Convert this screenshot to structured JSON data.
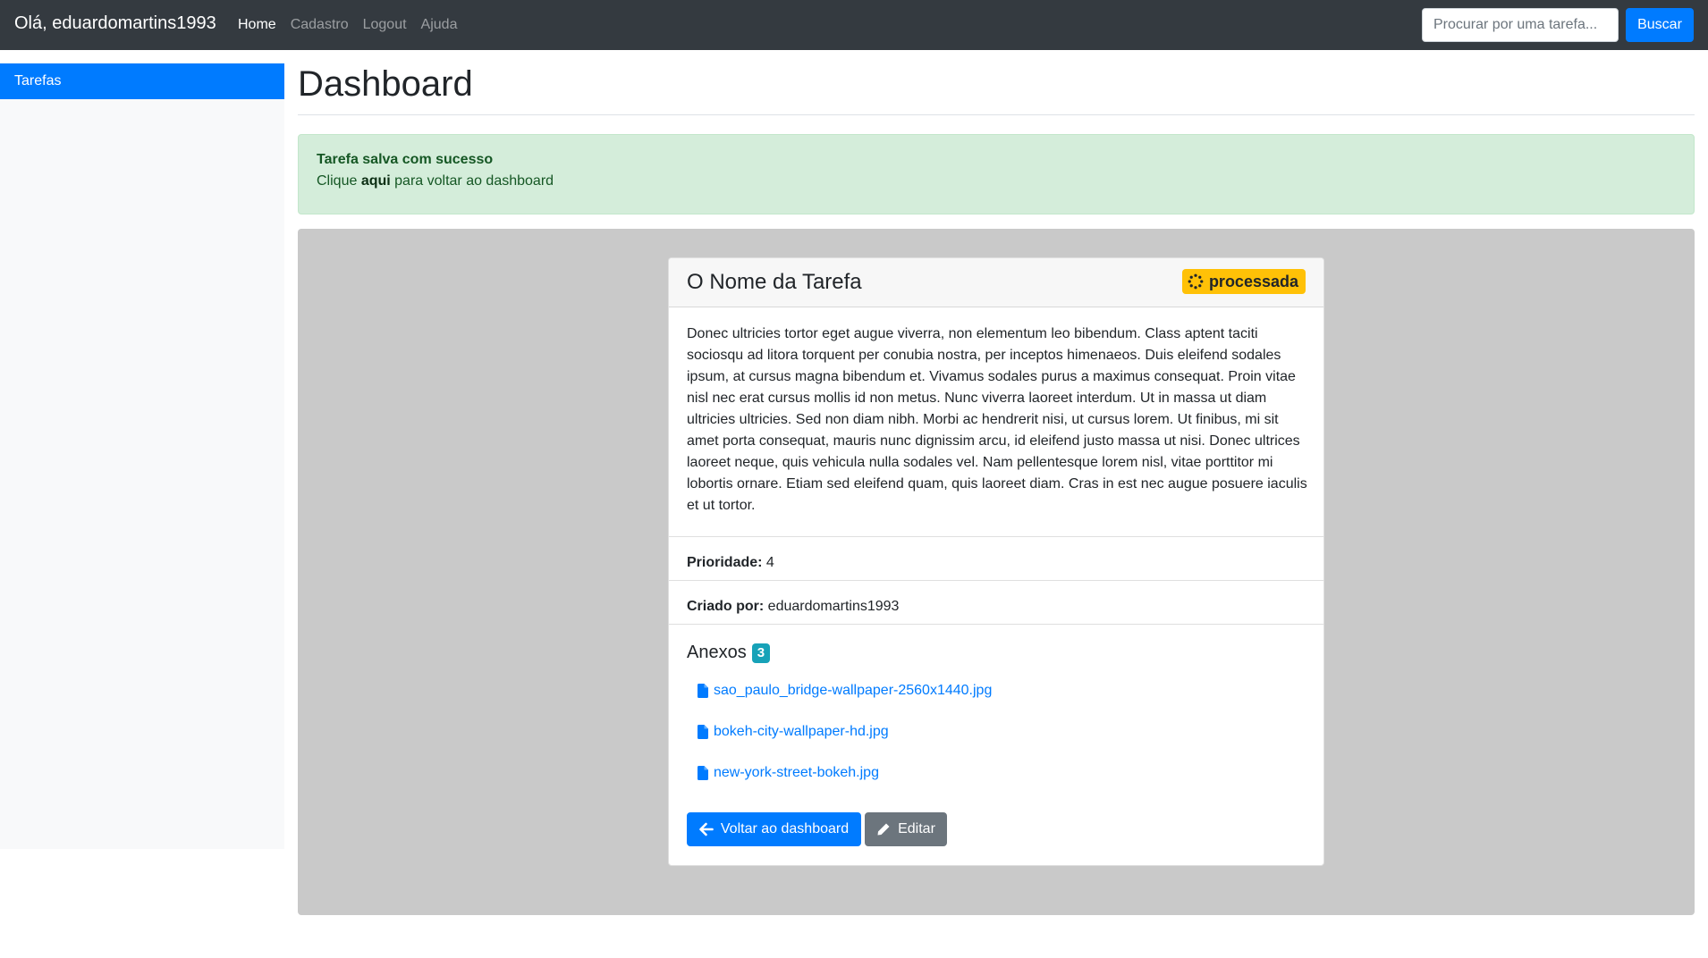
{
  "navbar": {
    "brand": "Olá, eduardomartins1993",
    "links": [
      "Home",
      "Cadastro",
      "Logout",
      "Ajuda"
    ],
    "search_placeholder": "Procurar por uma tarefa...",
    "search_button": "Buscar"
  },
  "sidebar": {
    "items": [
      "Tarefas"
    ]
  },
  "main": {
    "title": "Dashboard",
    "alert": {
      "title": "Tarefa salva com sucesso",
      "text_before": "Clique ",
      "link": "aqui",
      "text_after": " para voltar ao dashboard"
    },
    "task": {
      "name": "O Nome da Tarefa",
      "status": "processada",
      "description": "Donec ultricies tortor eget augue viverra, non elementum leo bibendum. Class aptent taciti sociosqu ad litora torquent per conubia nostra, per inceptos himenaeos. Duis eleifend sodales ipsum, at cursus magna bibendum et. Vivamus sodales purus a maximus consequat. Proin vitae nisl nec erat cursus mollis id non metus. Nunc viverra laoreet interdum. Ut in massa ut diam ultricies ultricies. Sed non diam nibh. Morbi ac hendrerit nisi, ut cursus lorem. Ut finibus, mi sit amet porta consequat, mauris nunc dignissim arcu, id eleifend justo massa ut nisi. Donec ultrices laoreet neque, quis vehicula nulla sodales vel. Nam pellentesque lorem nisl, vitae porttitor mi lobortis ornare. Etiam sed eleifend quam, quis laoreet diam. Cras in est nec augue posuere iaculis et ut tortor.",
      "priority_label": "Prioridade:",
      "priority_value": "4",
      "created_label": "Criado por:",
      "created_value": "eduardomartins1993",
      "attachments_title": "Anexos",
      "attachments_count": "3",
      "attachments": [
        "sao_paulo_bridge-wallpaper-2560x1440.jpg",
        "bokeh-city-wallpaper-hd.jpg",
        "new-york-street-bokeh.jpg"
      ],
      "back_button": "Voltar ao dashboard",
      "edit_button": "Editar"
    }
  },
  "colors": {
    "navbar_bg": "#343a40",
    "primary": "#007bff",
    "success_bg": "#d4edda",
    "warning": "#ffc107",
    "info": "#17a2b8",
    "secondary": "#6c757d"
  },
  "icons": {
    "status": "spinner-icon",
    "attachment": "file-icon",
    "back": "arrow-left-icon",
    "edit": "pencil-icon"
  }
}
